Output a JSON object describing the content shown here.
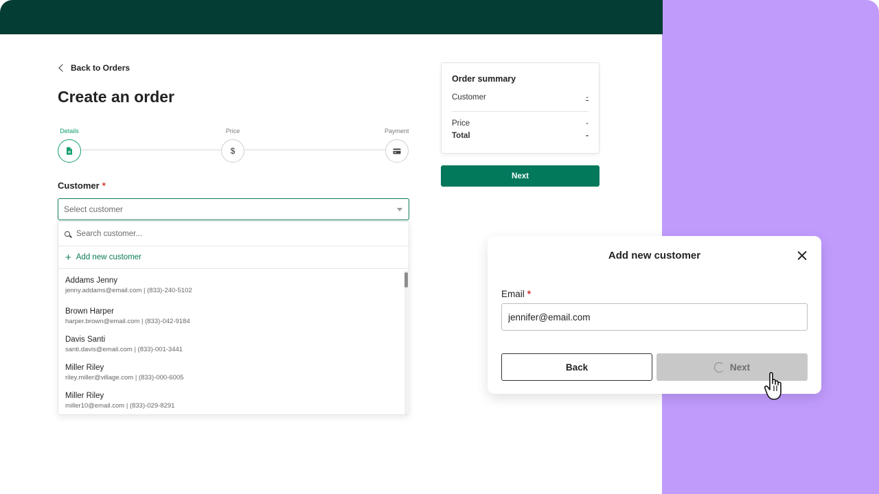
{
  "header": {
    "back_label": "Back to Orders",
    "title": "Create an order"
  },
  "stepper": {
    "steps": [
      {
        "label": "Details",
        "icon": "document-icon",
        "active": true
      },
      {
        "label": "Price",
        "icon": "dollar-icon",
        "active": false
      },
      {
        "label": "Payment",
        "icon": "credit-card-icon",
        "active": false
      }
    ],
    "price_glyph": "$"
  },
  "customer_field": {
    "label": "Customer",
    "required_mark": "*",
    "placeholder": "Select customer"
  },
  "dropdown": {
    "search_placeholder": "Search customer...",
    "add_label": "Add new customer",
    "add_glyph": "+",
    "customers": [
      {
        "name": "Addams Jenny",
        "meta": "jenny.addams@email.com | (833)-240-5102"
      },
      {
        "name": "Brown Harper",
        "meta": "harper.brown@email.com | (833)-042-9184"
      },
      {
        "name": "Davis Santi",
        "meta": "santi.davis@email.com | (833)-001-3441"
      },
      {
        "name": "Miller Riley",
        "meta": "riley.miller@village.com | (833)-000-6005"
      },
      {
        "name": "Miller Riley",
        "meta": "miller10@email.com | (833)-029-8291"
      }
    ]
  },
  "summary": {
    "title": "Order summary",
    "customer_label": "Customer",
    "customer_value": "-",
    "price_label": "Price",
    "price_value": "-",
    "total_label": "Total",
    "total_value": "-"
  },
  "next_button": {
    "label": "Next"
  },
  "modal": {
    "title": "Add new customer",
    "email_label": "Email",
    "required_mark": "*",
    "email_value": "jennifer@email.com",
    "back_label": "Back",
    "next_label": "Next"
  },
  "colors": {
    "topbar": "#033d33",
    "accent_green": "#03795c",
    "active_step": "#0f9d6e",
    "side_panel": "#c09bfc",
    "required": "#d0312d",
    "disabled_button": "#c8c8c8"
  }
}
